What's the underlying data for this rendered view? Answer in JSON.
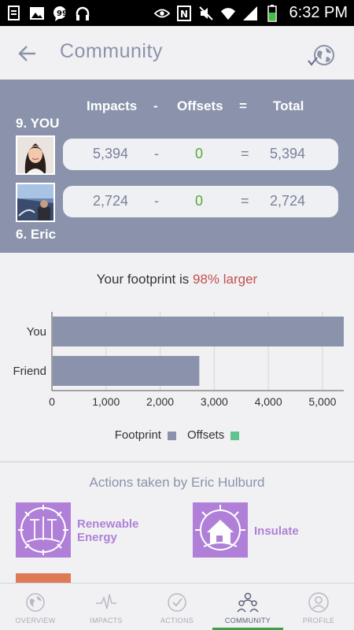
{
  "status_bar": {
    "time": "6:32 PM",
    "icons_left": [
      "document-icon",
      "image-icon",
      "messenger-icon",
      "headphones-icon"
    ],
    "icons_right": [
      "eye-icon",
      "nfc-icon",
      "mute-icon",
      "wifi-icon",
      "signal-icon",
      "battery-icon"
    ]
  },
  "app_bar": {
    "title": "Community",
    "back_icon": "back-arrow-icon",
    "globe_icon": "globe-check-icon"
  },
  "comparison": {
    "headers": {
      "impacts": "Impacts",
      "minus": "-",
      "offsets": "Offsets",
      "equals": "=",
      "total": "Total"
    },
    "rows": [
      {
        "rank_label": "9. YOU",
        "impacts": "5,394",
        "minus": "-",
        "offsets": "0",
        "equals": "=",
        "total": "5,394"
      },
      {
        "rank_label": "6. Eric",
        "impacts": "2,724",
        "minus": "-",
        "offsets": "0",
        "equals": "=",
        "total": "2,724"
      }
    ]
  },
  "footprint": {
    "prefix": "Your footprint is",
    "percent_text": "98% larger"
  },
  "chart_data": {
    "type": "bar",
    "orientation": "horizontal",
    "categories": [
      "You",
      "Friend"
    ],
    "series": [
      {
        "name": "Footprint",
        "values": [
          5394,
          2724
        ],
        "color": "#8a93ab"
      },
      {
        "name": "Offsets",
        "values": [
          0,
          0
        ],
        "color": "#5fc48f"
      }
    ],
    "xlim": [
      0,
      5394
    ],
    "xticks": [
      "0",
      "1,000",
      "2,000",
      "3,000",
      "4,000",
      "5,000"
    ],
    "grid": true,
    "legend_placement": "bottom"
  },
  "legend": {
    "footprint": "Footprint",
    "offsets": "Offsets"
  },
  "actions": {
    "title": "Actions taken by Eric Hulburd",
    "items": [
      {
        "label_line1": "Renewable",
        "label_line2": "Energy",
        "icon": "renewable-energy-icon"
      },
      {
        "label_line1": "Insulate",
        "label_line2": "",
        "icon": "insulate-icon"
      }
    ]
  },
  "bottom_nav": {
    "items": [
      {
        "label": "OVERVIEW",
        "icon": "earth-icon"
      },
      {
        "label": "IMPACTS",
        "icon": "pulse-icon"
      },
      {
        "label": "ACTIONS",
        "icon": "checkmark-icon"
      },
      {
        "label": "COMMUNITY",
        "icon": "people-icon",
        "active": true
      },
      {
        "label": "PROFILE",
        "icon": "profile-icon"
      }
    ]
  },
  "colors": {
    "accent": "#8a93ab",
    "highlight": "#c0504d",
    "green": "#58a83a",
    "action_tile": "#b080d8",
    "nav_active": "#3fa04a"
  }
}
